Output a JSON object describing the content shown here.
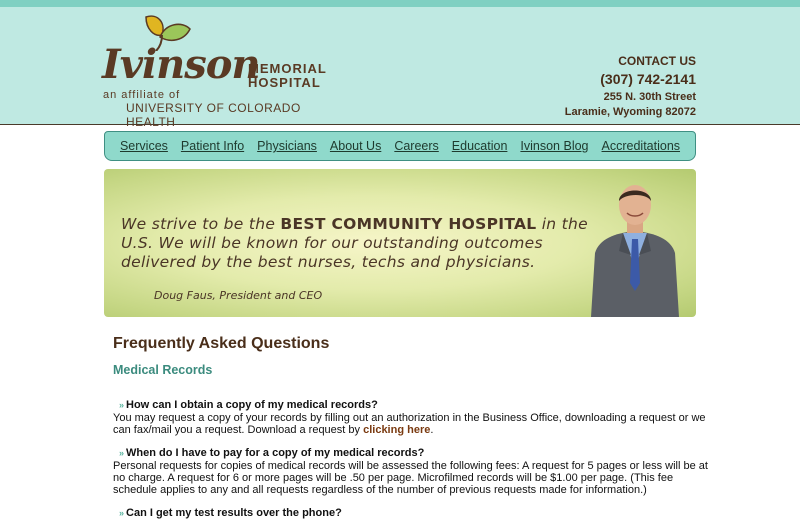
{
  "header": {
    "logo": {
      "name": "Ivinson",
      "memorial": "MEMORIAL",
      "hospital": "HOSPITAL",
      "affiliate": "an affiliate of",
      "university": "UNIVERSITY OF COLORADO HEALTH"
    },
    "contact": {
      "label": "CONTACT US",
      "phone": "(307) 742-2141",
      "street": "255 N. 30th Street",
      "city": "Laramie, Wyoming 82072"
    }
  },
  "nav": {
    "items": [
      "Services",
      "Patient Info",
      "Physicians",
      "About Us",
      "Careers",
      "Education",
      "Ivinson Blog",
      "Accreditations"
    ]
  },
  "banner": {
    "quote_part1": "We strive to be the ",
    "quote_bold": "BEST COMMUNITY HOSPITAL",
    "quote_part2": " in the U.S. We will be known for our outstanding outcomes delivered by the best nurses, techs and physicians.",
    "attribution": "Doug Faus, President and CEO"
  },
  "main": {
    "title": "Frequently Asked Questions",
    "section": "Medical Records",
    "faqs": [
      {
        "q": "How can I obtain a copy of my medical records?",
        "a": "You may request a copy of your records by filling out an authorization in the Business Office, downloading a request or we can fax/mail you a request. Download a request by ",
        "link": "clicking here",
        "a_end": "."
      },
      {
        "q": "When do I have to pay for a copy of my medical records?",
        "a": "Personal requests for copies of medical records will be assessed the following fees: A request for 5 pages or less will be at no charge. A request for 6 or more pages will be .50 per page. Microfilmed records will be $1.00 per page. (This fee schedule applies to any and all requests regardless of the number of previous requests made for information.)"
      },
      {
        "q": "Can I get my test results over the phone?"
      }
    ]
  },
  "colors": {
    "header_bg": "#bfe9e2",
    "nav_bg": "#8fd9cb",
    "brand_brown": "#5a3a24",
    "section_teal": "#3b8b7e",
    "link_brown": "#7a3a10"
  }
}
